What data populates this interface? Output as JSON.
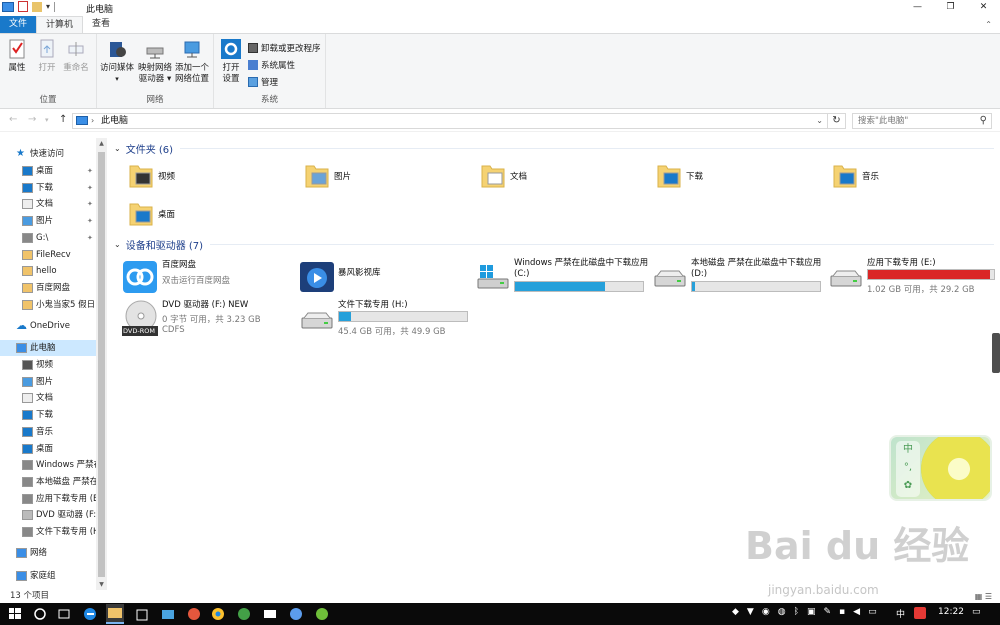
{
  "window": {
    "title": "此电脑",
    "controls": [
      "—",
      "❐",
      "✕"
    ]
  },
  "tabs": [
    "文件",
    "计算机",
    "查看"
  ],
  "ribbon": {
    "groups": {
      "location": "位置",
      "network": "网络",
      "system": "系统"
    },
    "buttons": {
      "properties": "属性",
      "open": "打开",
      "rename": "重命名",
      "access_media": "访问媒体",
      "map_drive_1": "映射网络",
      "map_drive_2": "驱动器 ▾",
      "add_location_1": "添加一个",
      "add_location_2": "网络位置",
      "open_settings_1": "打开",
      "open_settings_2": "设置",
      "uninstall": "卸载或更改程序",
      "system_properties": "系统属性",
      "manage": "管理"
    }
  },
  "address": {
    "path": "此电脑",
    "search_placeholder": "搜索\"此电脑\""
  },
  "nav": {
    "quick_access": "快速访问",
    "qa_items": [
      "桌面",
      "下载",
      "文档",
      "图片",
      "G:\\",
      "FileRecv",
      "hello",
      "百度网盘",
      "小鬼当家5  假日"
    ],
    "onedrive": "OneDrive",
    "this_pc": "此电脑",
    "pc_items": [
      "视频",
      "图片",
      "文档",
      "下载",
      "音乐",
      "桌面",
      "Windows 严禁在",
      "本地磁盘 严禁在",
      "应用下载专用 (E",
      "DVD 驱动器 (F:)",
      "文件下载专用 (H"
    ],
    "network": "网络",
    "homegroup": "家庭组"
  },
  "folders_section": {
    "title": "文件夹 (6)",
    "items": [
      "视频",
      "图片",
      "文档",
      "下载",
      "音乐",
      "桌面"
    ]
  },
  "devices_section": {
    "title": "设备和驱动器 (7)",
    "baidu": {
      "name": "百度网盘",
      "sub": "双击运行百度网盘"
    },
    "baofeng": {
      "name": "暴风影视库"
    },
    "c_drive": {
      "name": "Windows 严禁在此磁盘中下载应用 (C:)",
      "fill": 0.7
    },
    "d_drive": {
      "name": "本地磁盘 严禁在此磁盘中下载应用 (D:)",
      "fill": 0.02
    },
    "e_drive": {
      "name": "应用下载专用 (E:)",
      "free": "1.02 GB 可用，共 29.2 GB",
      "fill": 0.97
    },
    "dvd": {
      "name": "DVD 驱动器 (F:) NEW",
      "free": "0 字节 可用，共 3.23 GB",
      "fs": "CDFS",
      "label": "DVD-ROM"
    },
    "h_drive": {
      "name": "文件下载专用 (H:)",
      "free": "45.4 GB 可用，共 49.9 GB",
      "fill": 0.09
    }
  },
  "status": {
    "count": "13 个项目"
  },
  "widget": {
    "btn1": "中",
    "btn2": "°,",
    "btn3": "✿"
  },
  "watermark": {
    "main": "Bai du 经验",
    "url": "jingyan.baidu.com"
  },
  "taskbar": {
    "ime": "中",
    "time": "12:22"
  },
  "colors": {
    "accent": "#1979ca",
    "bar_normal": "#26a0da",
    "bar_full": "#da2626",
    "selection": "#cce8ff",
    "section_title": "#1e3f8b"
  }
}
